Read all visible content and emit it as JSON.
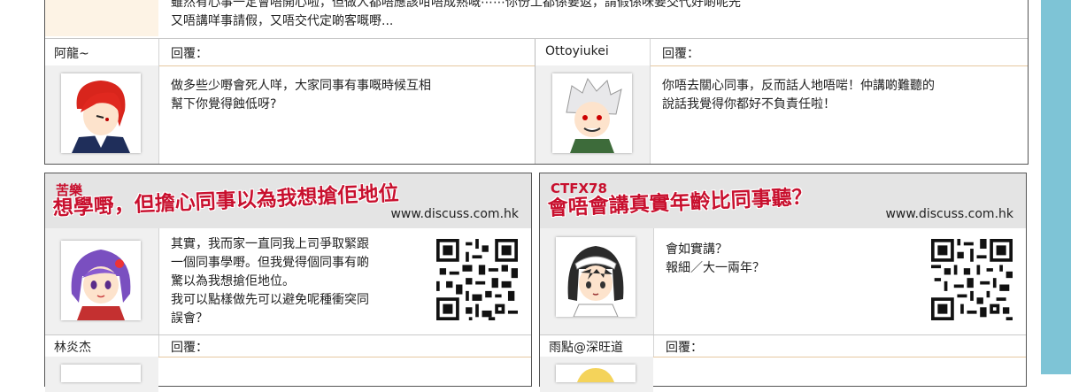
{
  "top": {
    "text_lines": [
      "雖然有心事一定會唔開心啦，但做人都唔應該咁唔成熟嘅⋯⋯你份工都係要返，請假係咪要交代好啲呢先",
      "又唔講咩事請假，又唔交代定啲客嘅嘢..."
    ],
    "left_user": "阿龍~",
    "right_user": "Ottoyiukei",
    "reply_label": "回覆：",
    "left_post_lines": [
      "做多些少嘢會死人咩，大家同事有事嘅時候互相",
      "幫下你覺得蝕低呀?"
    ],
    "right_post_lines": [
      "你唔去關心同事，反而話人地唔啱！仲講啲難聽的",
      "說話我覺得你都好不負責任啦！"
    ]
  },
  "left_panel": {
    "username": "苦樂",
    "title": "想學嘢，但擔心同事以為我想搶佢地位",
    "site": "www.discuss.com.hk",
    "post_lines": [
      "其實，我而家一直同我上司爭取緊跟",
      "一個同事學嘢。但我覺得個同事有啲",
      "驚以為我想搶佢地位。",
      "我可以點樣做先可以避免呢種衝突同",
      "誤會？"
    ],
    "reply_user": "林炎杰",
    "reply_label": "回覆："
  },
  "right_panel": {
    "username": "CTFX78",
    "title": "會唔會講真實年齡比同事聽？",
    "site": "www.discuss.com.hk",
    "post_lines": [
      "會如實講？",
      "報細／大一兩年？"
    ],
    "reply_user": "雨點@深旺道",
    "reply_label": "回覆："
  },
  "colors": {
    "accent_red": "#c8102e",
    "side_blue": "#7ec4d6",
    "header_gray": "#e4e4e4"
  }
}
